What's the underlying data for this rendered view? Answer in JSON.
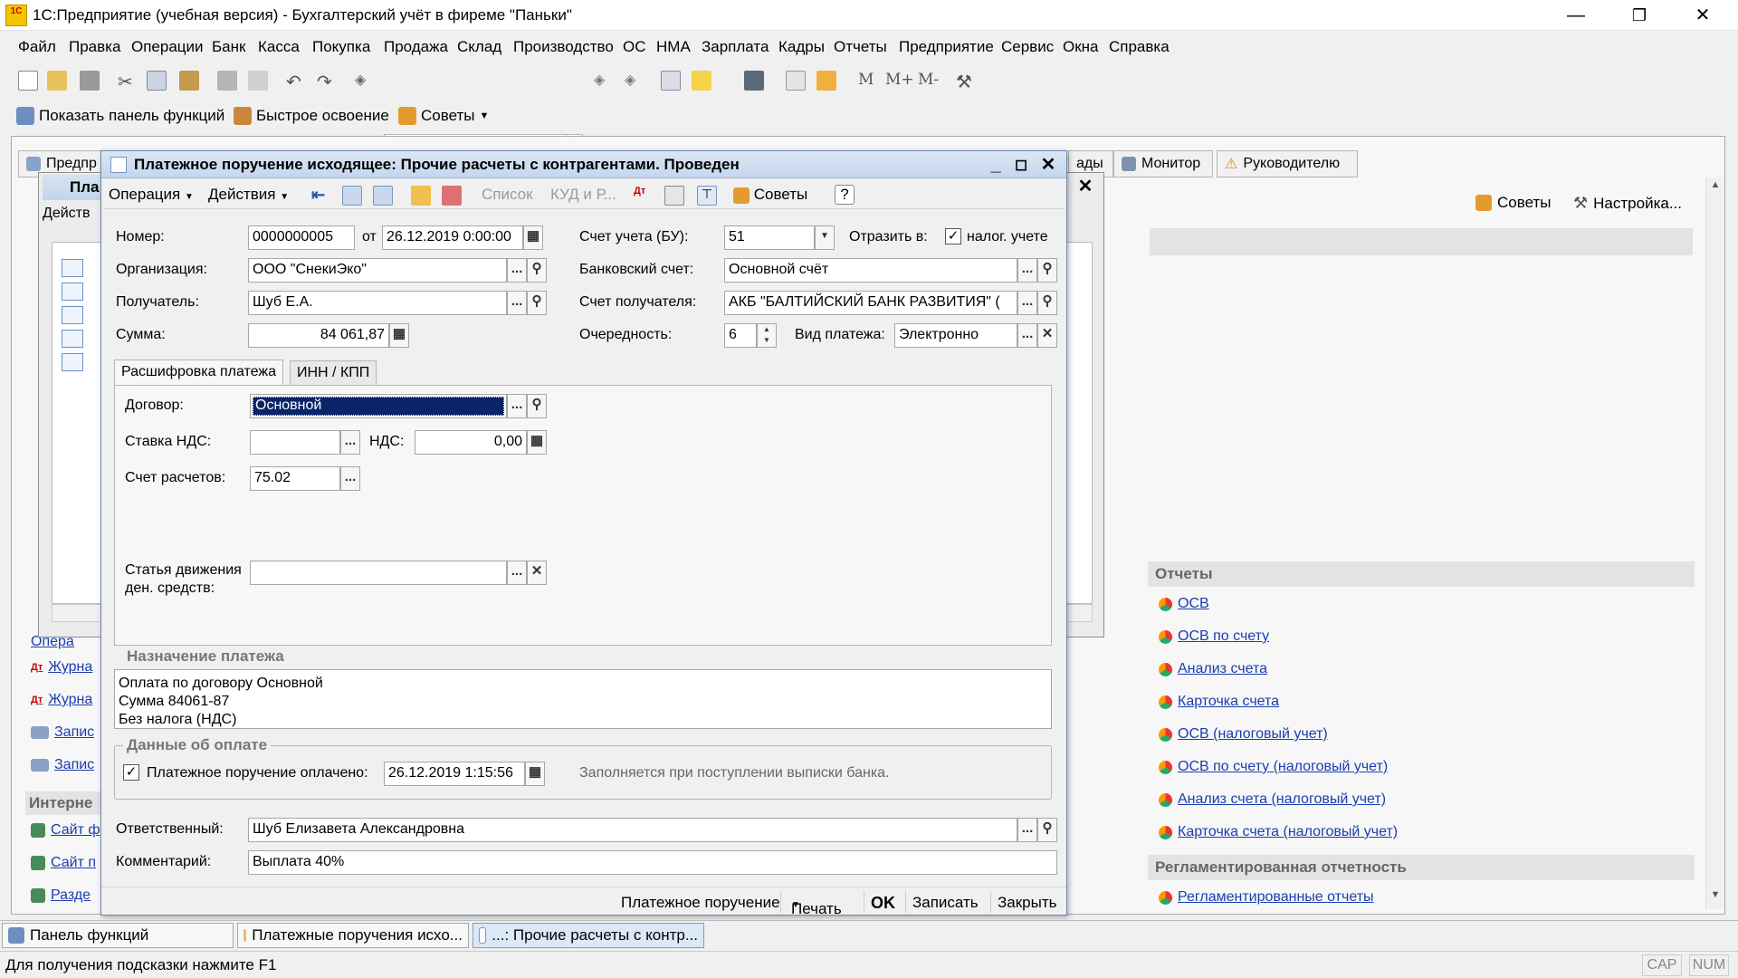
{
  "window": {
    "title": "1С:Предприятие (учебная версия) - Бухгалтерский учёт в фиреме \"Паньки\"",
    "logo": "1С"
  },
  "menu": [
    "Файл",
    "Правка",
    "Операции",
    "Банк",
    "Касса",
    "Покупка",
    "Продажа",
    "Склад",
    "Производство",
    "ОС",
    "НМА",
    "Зарплата",
    "Кадры",
    "Отчеты",
    "Предприятие",
    "Сервис",
    "Окна",
    "Справка"
  ],
  "toolbar_letters": [
    "M",
    "M+",
    "M-"
  ],
  "toolbar2": {
    "show_panel": "Показать панель функций",
    "quick_learn": "Быстрое освоение",
    "tips": "Советы"
  },
  "bg_tabs": {
    "left_partial": "Предпр",
    "mid_partial": "ады",
    "monitor": "Монитор",
    "manager": "Руководителю"
  },
  "right_panel": {
    "tips": "Советы",
    "settings": "Настройка...",
    "reports_header": "Отчеты",
    "reports": [
      "ОСВ",
      "ОСВ по счету",
      "Анализ счета",
      "Карточка счета",
      "ОСВ (налоговый учет)",
      "ОСВ по счету (налоговый учет)",
      "Анализ счета (налоговый учет)",
      "Карточка счета (налоговый учет)"
    ],
    "reg_header": "Регламентированная отчетность",
    "reg_reports": [
      "Регламентированные отчеты"
    ]
  },
  "left_panel": {
    "items": [
      "Опера",
      "Журна",
      "Журна",
      "Запис",
      "Запис"
    ],
    "internet_header": "Интерне",
    "internet_items": [
      "Сайт ф",
      "Сайт п",
      "Разде"
    ]
  },
  "list_window": {
    "title": "Пла",
    "actions": "Действ"
  },
  "dialog": {
    "title": "Платежное поручение исходящее: Прочие расчеты с контрагентами. Проведен",
    "toolbar": {
      "operation": "Операция",
      "actions": "Действия",
      "list": "Список",
      "kud": "КУД и Р...",
      "tips": "Советы",
      "help": "?"
    },
    "fields": {
      "number_label": "Номер:",
      "number": "0000000005",
      "from_label": "от",
      "date": "26.12.2019 0:00:00",
      "account_label": "Счет учета (БУ):",
      "account": "51",
      "reflect_label": "Отразить в:",
      "tax_label": "налог. учете",
      "org_label": "Организация:",
      "org": "ООО \"СнекиЭко\"",
      "bank_account_label": "Банковский счет:",
      "bank_account": "Основной счёт",
      "recipient_label": "Получатель:",
      "recipient": "Шуб Е.А.",
      "recipient_account_label": "Счет получателя:",
      "recipient_account": "АКБ \"БАЛТИЙСКИЙ БАНК РАЗВИТИЯ\" (",
      "sum_label": "Сумма:",
      "sum": "84 061,87",
      "priority_label": "Очередность:",
      "priority": "6",
      "payment_type_label": "Вид платежа:",
      "payment_type": "Электронно"
    },
    "tabs": [
      "Расшифровка платежа",
      "ИНН / КПП"
    ],
    "detail": {
      "contract_label": "Договор:",
      "contract": "Основной",
      "vat_rate_label": "Ставка НДС:",
      "vat_rate": "",
      "vat_label": "НДС:",
      "vat": "0,00",
      "settle_label": "Счет расчетов:",
      "settle": "75.02",
      "cashflow_label_1": "Статья движения",
      "cashflow_label_2": "ден. средств:",
      "cashflow": ""
    },
    "purpose": {
      "header": "Назначение платежа",
      "lines": [
        "Оплата по договору Основной",
        "Сумма 84061-87",
        "Без налога (НДС)"
      ]
    },
    "payment": {
      "header": "Данные об оплате",
      "paid_label": "Платежное поручение оплачено:",
      "paid_date": "26.12.2019  1:15:56",
      "note": "Заполняется при поступлении выписки банка."
    },
    "responsible_label": "Ответственный:",
    "responsible": "Шуб Елизавета Александровна",
    "comment_label": "Комментарий:",
    "comment": "Выплата 40%",
    "bottom": {
      "print_form": "Платежное поручение",
      "print": "Печать",
      "ok": "OK",
      "save": "Записать",
      "close": "Закрыть"
    }
  },
  "taskbar": [
    "Панель функций",
    "Платежные поручения исхо...",
    "...: Прочие расчеты с контр..."
  ],
  "status": {
    "hint": "Для получения подсказки нажмите F1",
    "cap": "CAP",
    "num": "NUM"
  },
  "colors": {
    "accent": "#1a3eb0",
    "dialog_title": "#c5d6ee",
    "selection": "#0a246a"
  }
}
